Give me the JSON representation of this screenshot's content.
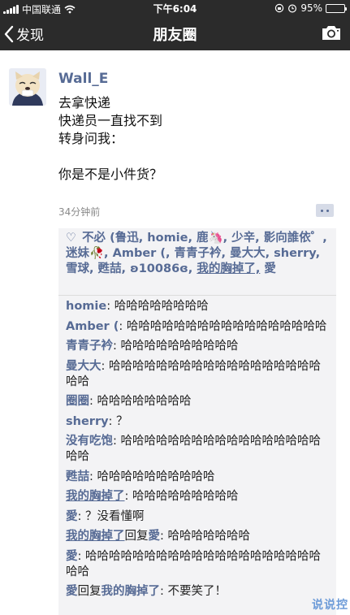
{
  "status_bar": {
    "carrier": "中国联通",
    "time": "下午6:04",
    "battery_percent": "95%",
    "battery_level": 0.95,
    "icons": [
      "signal-icon",
      "wifi-icon",
      "lock-rotation-icon",
      "alarm-icon",
      "battery-icon"
    ]
  },
  "nav": {
    "back_label": "发现",
    "title": "朋友圈",
    "camera_icon": "camera-icon"
  },
  "post": {
    "author": "Wall_E",
    "lines": [
      "去拿快递",
      "快递员一直找不到",
      "转身问我：",
      "",
      "你是不是小件货？"
    ],
    "time": "34分钟前"
  },
  "likes": {
    "text": "不必 (鲁迅, homie, 鹿🦄, 少辛, 影向誰依゜, 迷妹🥀, Amber (, 青青子衿, 曼大大, sherry, 雪球, 甦喆, ʚ10086ɞ, ",
    "highlight": "我的胸掉了,",
    "last": " 愛"
  },
  "comments": [
    {
      "author": "homie",
      "text": ": 哈哈哈哈哈哈哈哈"
    },
    {
      "author": "Amber (",
      "text": ": 哈哈哈哈哈哈哈哈哈哈哈哈哈哈哈哈哈"
    },
    {
      "author": "青青子衿",
      "text": ": 哈哈哈哈哈哈哈哈哈哈"
    },
    {
      "author": "曼大大",
      "text": ": 哈哈哈哈哈哈哈哈哈哈哈哈哈哈哈哈哈哈哈哈"
    },
    {
      "author": "圈圈",
      "text": ": 哈哈哈哈哈哈哈哈"
    },
    {
      "author": "sherry",
      "text": ": ？"
    },
    {
      "author": "没有吃饱",
      "text": ": 哈哈哈哈哈哈哈哈哈哈哈哈哈哈哈哈哈哈哈"
    },
    {
      "author": "甦喆",
      "text": ": 哈哈哈哈哈哈哈哈哈哈"
    },
    {
      "author": "我的胸掉了",
      "text": ": 哈哈哈哈哈哈哈哈哈",
      "underline": true
    },
    {
      "author": "愛",
      "text": ": ？没看懂啊"
    },
    {
      "author": "我的胸掉了",
      "reply_word": "回复",
      "reply_to": "愛",
      "text": ": 哈哈哈哈哈哈哈",
      "underline": true
    },
    {
      "author": "愛",
      "text": ": 哈哈哈哈哈哈哈哈哈哈哈哈哈哈哈哈哈哈哈哈哈哈"
    },
    {
      "author": "愛",
      "reply_word": "回复",
      "reply_to": "我的胸掉了",
      "text": ": 不要笑了！"
    }
  ],
  "watermark": "说说控",
  "colors": {
    "bar_background": "#2b2b2b",
    "link_blue": "#576b95",
    "box_background": "#f3f3f5",
    "battery_yellow": "#f5c518"
  }
}
